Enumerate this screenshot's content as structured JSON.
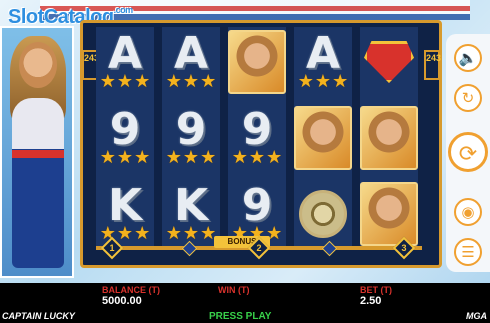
{
  "watermark": {
    "text": "SlotCatalog",
    "suffix": ".com"
  },
  "reel_badge": {
    "left": "243",
    "right": "243"
  },
  "reels": [
    [
      {
        "sym": "A",
        "stars": 3
      },
      {
        "sym": "9",
        "stars": 3
      },
      {
        "sym": "K",
        "stars": 3
      }
    ],
    [
      {
        "sym": "A",
        "stars": 3
      },
      {
        "sym": "9",
        "stars": 3
      },
      {
        "sym": "K",
        "stars": 3
      }
    ],
    [
      {
        "sym": "portrait"
      },
      {
        "sym": "9",
        "stars": 3
      },
      {
        "sym": "9",
        "stars": 3
      }
    ],
    [
      {
        "sym": "A",
        "stars": 3
      },
      {
        "sym": "portrait"
      },
      {
        "sym": "orb"
      }
    ],
    [
      {
        "sym": "emblem"
      },
      {
        "sym": "portrait"
      },
      {
        "sym": "portrait"
      }
    ]
  ],
  "bonus": {
    "label": "BONUS",
    "nodes": [
      "1",
      "2",
      "3"
    ]
  },
  "controls": {
    "sound_icon": "speaker-icon",
    "autoplay_icon": "autoplay-icon",
    "spin_icon": "spin-icon",
    "bet_icon": "coin-stack-icon",
    "menu_icon": "menu-icon"
  },
  "footer": {
    "balance_label": "BALANCE (T)",
    "balance_value": "5000.00",
    "win_label": "WIN (T)",
    "bet_label": "BET (T)",
    "bet_value": "2.50",
    "game_name": "CAPTAIN LUCKY",
    "status": "PRESS PLAY",
    "license": "MGA"
  },
  "colors": {
    "accent": "#f3b21e",
    "frame": "#d79a2d",
    "status": "#38d04a",
    "label": "#d8322c"
  }
}
